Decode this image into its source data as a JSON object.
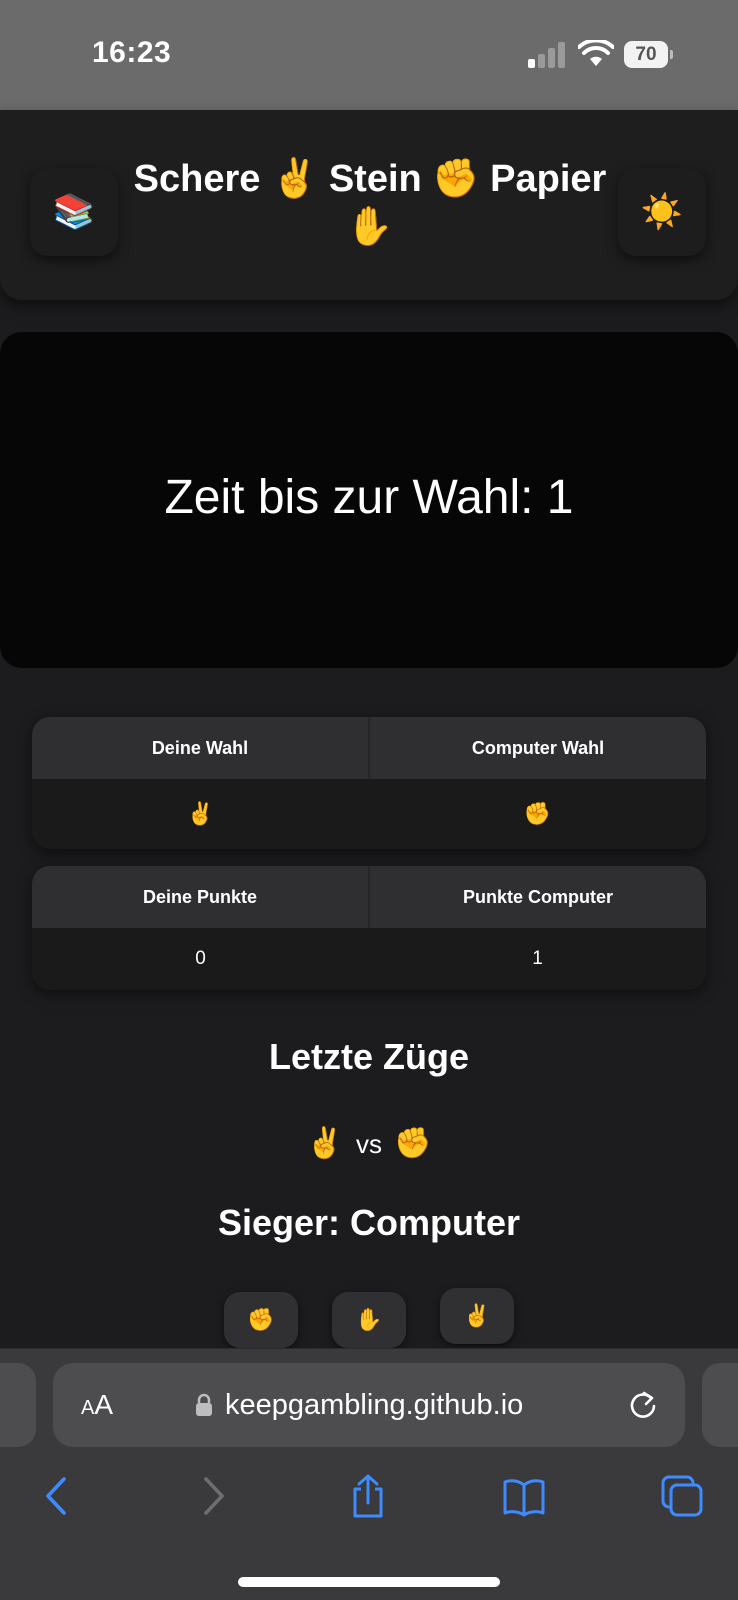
{
  "status_bar": {
    "time": "16:23",
    "battery_level": "70",
    "icons": [
      "signal-icon",
      "wifi-icon",
      "battery-icon"
    ]
  },
  "header": {
    "title_line1": "Schere ✌️ Stein ✊ Papier",
    "title_line2": "✋",
    "left_button_icon": "📚",
    "right_button_icon": "☀️"
  },
  "timer": {
    "text": "Zeit bis zur Wahl: 1"
  },
  "choice_table": {
    "headers": [
      "Deine Wahl",
      "Computer Wahl"
    ],
    "values": [
      "✌️",
      "✊"
    ]
  },
  "points_table": {
    "headers": [
      "Deine Punkte",
      "Punkte Computer"
    ],
    "values": [
      "0",
      "1"
    ]
  },
  "history": {
    "title": "Letzte Züge",
    "player_move": "✌️",
    "vs_label": "vs",
    "computer_move": "✊",
    "winner_text": "Sieger: Computer"
  },
  "move_buttons": [
    {
      "label": "✊"
    },
    {
      "label": "✋"
    },
    {
      "label": "✌️"
    }
  ],
  "browser": {
    "aa_label_small": "A",
    "aa_label_big": "A",
    "url": "keepgambling.github.io",
    "accent_color": "#3d8bfd"
  }
}
